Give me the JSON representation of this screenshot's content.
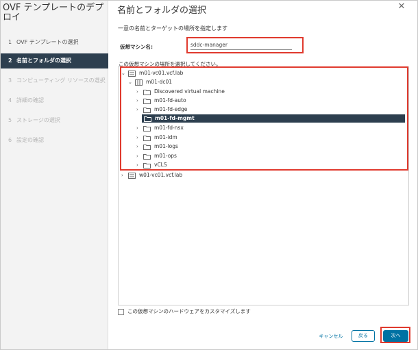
{
  "wizard": {
    "title": "OVF テンプレートのデプロイ",
    "steps": [
      {
        "num": "1",
        "label": "OVF テンプレートの選択",
        "state": "done"
      },
      {
        "num": "2",
        "label": "名前とフォルダの選択",
        "state": "active"
      },
      {
        "num": "3",
        "label": "コンピューティング リソースの選択",
        "state": "disabled"
      },
      {
        "num": "4",
        "label": "詳細の確認",
        "state": "disabled"
      },
      {
        "num": "5",
        "label": "ストレージの選択",
        "state": "disabled"
      },
      {
        "num": "6",
        "label": "設定の確認",
        "state": "disabled"
      }
    ]
  },
  "page": {
    "title": "名前とフォルダの選択",
    "instruction": "一意の名前とターゲットの場所を指定します",
    "vm_name_label": "仮想マシン名:",
    "vm_name_value": "sddc-manager",
    "location_label": "この仮想マシンの場所を選択してください。"
  },
  "tree": {
    "items": [
      {
        "label": "m01-vc01.vcf.lab",
        "icon": "vcenter-icon",
        "chevron": "⌄"
      },
      {
        "label": "m01-dc01",
        "icon": "datacenter-icon",
        "chevron": "⌄"
      },
      {
        "label": "Discovered virtual machine",
        "icon": "folder-icon",
        "chevron": "›"
      },
      {
        "label": "m01-fd-auto",
        "icon": "folder-icon",
        "chevron": "›"
      },
      {
        "label": "m01-fd-edge",
        "icon": "folder-icon",
        "chevron": "›"
      },
      {
        "label": "m01-fd-mgmt",
        "icon": "folder-icon",
        "chevron": "",
        "selected": true
      },
      {
        "label": "m01-fd-nsx",
        "icon": "folder-icon",
        "chevron": "›"
      },
      {
        "label": "m01-idm",
        "icon": "folder-icon",
        "chevron": "›"
      },
      {
        "label": "m01-logs",
        "icon": "folder-icon",
        "chevron": "›"
      },
      {
        "label": "m01-ops",
        "icon": "folder-icon",
        "chevron": "›"
      },
      {
        "label": "vCLS",
        "icon": "folder-icon",
        "chevron": "›"
      },
      {
        "label": "w01-vc01.vcf.lab",
        "icon": "vcenter-icon",
        "chevron": "›"
      }
    ]
  },
  "customize_hw_label": "この仮想マシンのハードウェアをカスタマイズします",
  "footer": {
    "cancel": "キャンセル",
    "back": "戻る",
    "next": "次へ"
  },
  "colors": {
    "accent": "#0072a3",
    "selected_bg": "#2d3f4f",
    "highlight_red": "#e03a2e"
  }
}
